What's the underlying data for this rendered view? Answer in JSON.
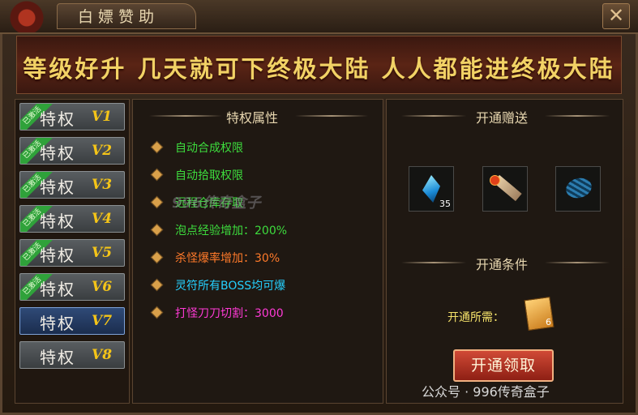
{
  "window": {
    "title": "白嫖赞助",
    "close_label": "✕"
  },
  "banner": {
    "text": "等级好升  几天就可下终极大陆  人人都能进终极大陆"
  },
  "vip_list": [
    {
      "label": "特权",
      "level": "V1",
      "ribbon": "已激活",
      "active": false
    },
    {
      "label": "特权",
      "level": "V2",
      "ribbon": "已激活",
      "active": false
    },
    {
      "label": "特权",
      "level": "V3",
      "ribbon": "已激活",
      "active": false
    },
    {
      "label": "特权",
      "level": "V4",
      "ribbon": "已激活",
      "active": false
    },
    {
      "label": "特权",
      "level": "V5",
      "ribbon": "已激活",
      "active": false
    },
    {
      "label": "特权",
      "level": "V6",
      "ribbon": "已激活",
      "active": false
    },
    {
      "label": "特权",
      "level": "V7",
      "ribbon": "",
      "active": true
    },
    {
      "label": "特权",
      "level": "V8",
      "ribbon": "",
      "active": false
    }
  ],
  "attributes": {
    "heading": "特权属性",
    "items": [
      {
        "text": "自动合成权限",
        "color": "#3ddc3d"
      },
      {
        "text": "自动拾取权限",
        "color": "#3ddc3d"
      },
      {
        "text": "远程仓库存取",
        "color": "#3ddc3d"
      },
      {
        "text": "泡点经验增加：200%",
        "color": "#3ddc3d"
      },
      {
        "text": "杀怪爆率增加：30%",
        "color": "#ff7a2a"
      },
      {
        "text": "灵符所有BOSS均可爆",
        "color": "#25d0ff"
      },
      {
        "text": "打怪刀刀切割：3000",
        "color": "#ff3ad6"
      }
    ]
  },
  "rewards": {
    "heading": "开通赠送",
    "slots": [
      {
        "icon": "blue-crystal-icon",
        "qty": "35"
      },
      {
        "icon": "fire-scroll-icon",
        "qty": ""
      },
      {
        "icon": "blue-egg-icon",
        "qty": ""
      }
    ]
  },
  "conditions": {
    "heading": "开通条件",
    "need_label": "开通所需：",
    "item_icon": "gold-ticket-icon",
    "item_qty": "6",
    "button_label": "开通领取"
  },
  "watermark": "996传奇盒子",
  "footer": {
    "wechat": "公众号 · 996传奇盒子"
  }
}
